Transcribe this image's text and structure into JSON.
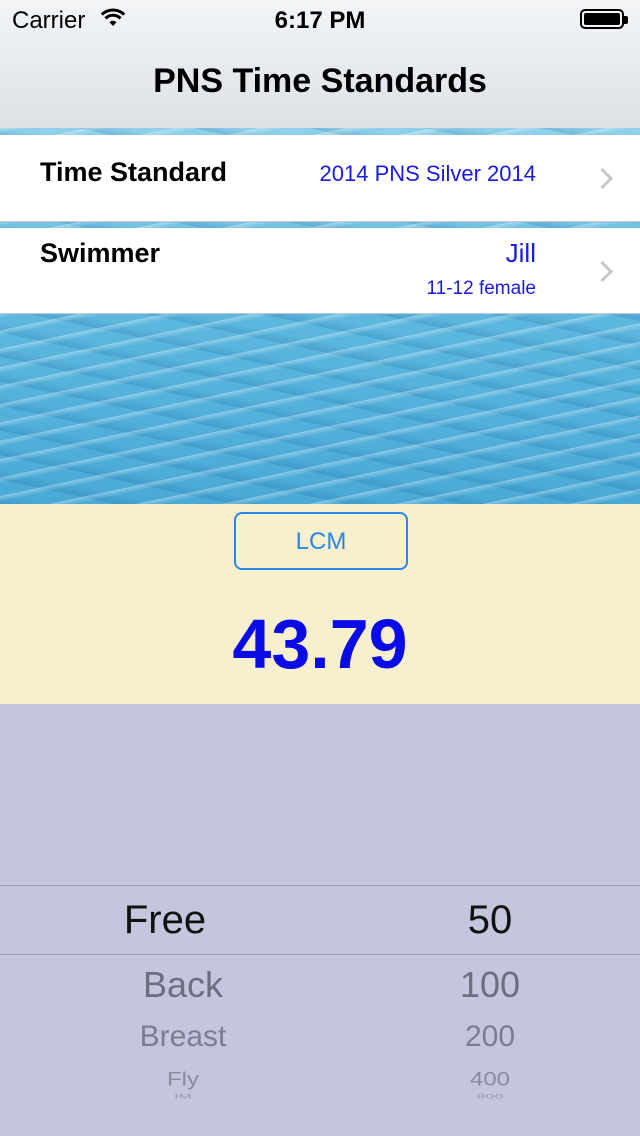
{
  "status_bar": {
    "carrier": "Carrier",
    "time": "6:17 PM",
    "battery_level": 1.0
  },
  "nav": {
    "title": "PNS Time Standards"
  },
  "time_standard_row": {
    "label": "Time Standard",
    "value": "2014 PNS Silver 2014"
  },
  "swimmer_row": {
    "label": "Swimmer",
    "name": "Jill",
    "detail": "11-12 female"
  },
  "result": {
    "course_button": "LCM",
    "time": "43.79"
  },
  "picker": {
    "strokes": [
      "Free",
      "Back",
      "Breast",
      "Fly",
      "IM"
    ],
    "distances": [
      "50",
      "100",
      "200",
      "400",
      "800"
    ],
    "selected_stroke": "Free",
    "selected_distance": "50"
  },
  "colors": {
    "accent_blue": "#1a1ae6",
    "button_blue": "#2a86e8",
    "result_bg": "#f7f0ce",
    "picker_bg": "#c3c6dd"
  }
}
